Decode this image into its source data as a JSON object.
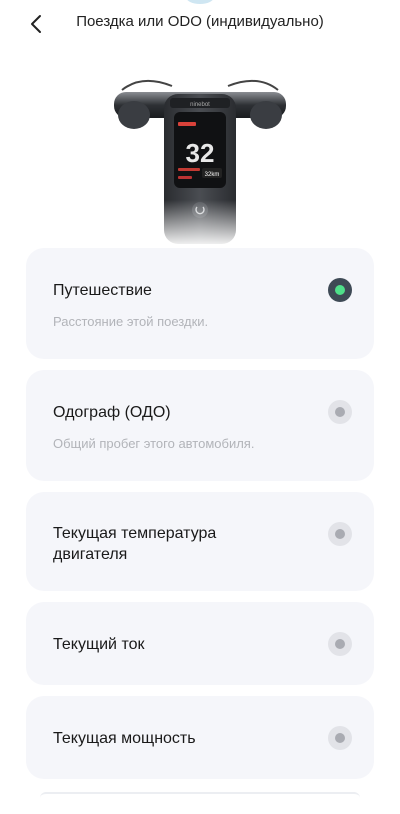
{
  "header": {
    "title": "Поездка или ODO (индивидуально)",
    "back_icon": "chevron-left-icon"
  },
  "device_image": {
    "speed": "32",
    "distance": "32km",
    "icon": "scooter-dashboard-image"
  },
  "options": [
    {
      "title": "Путешествие",
      "description": "Расстояние этой поездки.",
      "selected": true
    },
    {
      "title": "Одограф (ОДО)",
      "description": "Общий пробег этого автомобиля.",
      "selected": false
    },
    {
      "title": "Текущая температура двигателя",
      "description": "",
      "selected": false
    },
    {
      "title": "Текущий ток",
      "description": "",
      "selected": false
    },
    {
      "title": "Текущая мощность",
      "description": "",
      "selected": false
    }
  ],
  "colors": {
    "card_bg": "#f5f6fa",
    "radio_selected": "#3e4a55",
    "radio_selected_dot": "#4fe08a",
    "radio_unselected": "#e2e3e8"
  }
}
